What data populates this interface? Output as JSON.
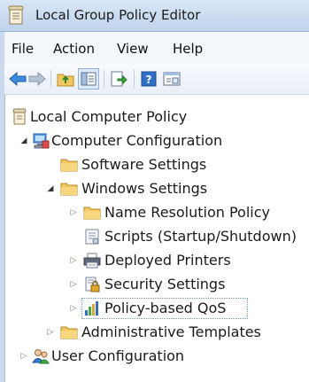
{
  "window": {
    "title": "Local Group Policy Editor"
  },
  "menu": {
    "items": [
      "File",
      "Action",
      "View",
      "Help"
    ]
  },
  "toolbar": {
    "buttons": [
      "back-icon",
      "forward-icon",
      "up-folder-icon",
      "show-hide-tree-icon",
      "export-list-icon",
      "help-icon",
      "properties-icon"
    ]
  },
  "tree": {
    "root": "Local Computer Policy",
    "computer_configuration": "Computer Configuration",
    "software_settings": "Software Settings",
    "windows_settings": "Windows Settings",
    "name_resolution_policy": "Name Resolution Policy",
    "scripts": "Scripts (Startup/Shutdown)",
    "deployed_printers": "Deployed Printers",
    "security_settings": "Security Settings",
    "policy_based_qos": "Policy-based QoS",
    "administrative_templates": "Administrative Templates",
    "user_configuration": "User Configuration"
  },
  "colors": {
    "accent": "#3a7bd5",
    "folder": "#f2c75c",
    "selection_border": "#7a9ac6"
  }
}
